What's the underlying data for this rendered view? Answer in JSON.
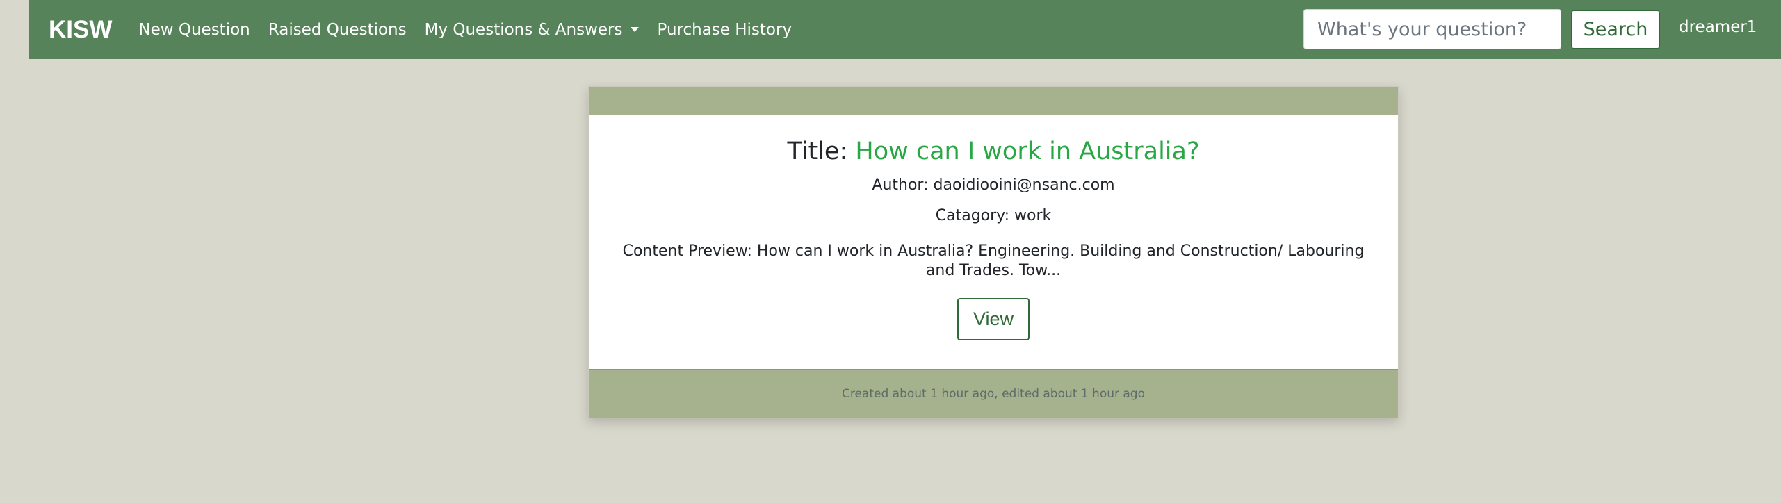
{
  "navbar": {
    "brand": "KISW",
    "links": [
      {
        "label": "New Question"
      },
      {
        "label": "Raised Questions"
      },
      {
        "label": "My Questions & Answers"
      },
      {
        "label": "Purchase History"
      }
    ],
    "search": {
      "placeholder": "What's your question?",
      "button_label": "Search"
    },
    "user": "dreamer1"
  },
  "card": {
    "title_label": "Title: ",
    "title_value": "How can I work in Australia?",
    "author": "Author: daoidiooini@nsanc.com",
    "category": "Catagory: work",
    "preview": "Content Preview: How can I work in Australia? Engineering. Building and Construction/ Labouring and Trades. Tow...",
    "view_label": "View",
    "footer": "Created about 1 hour ago, edited about 1 hour ago"
  },
  "colors": {
    "navbar": "#56835a",
    "card_band": "#a5b28d",
    "title_accent": "#28a745",
    "page_background": "#d9d8cc"
  }
}
